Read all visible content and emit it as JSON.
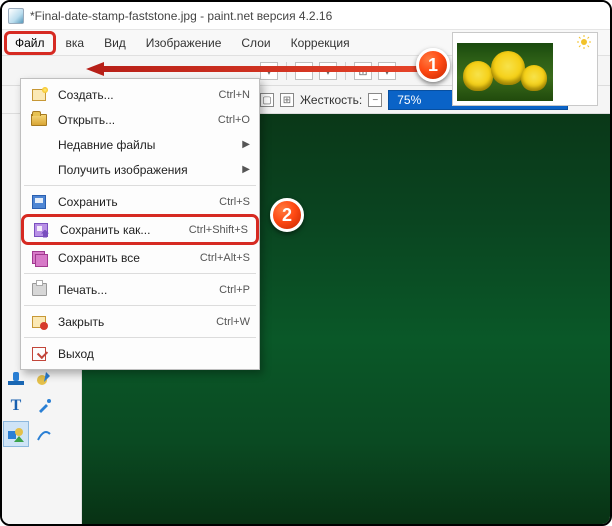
{
  "title": "*Final-date-stamp-faststone.jpg - paint.net версия 4.2.16",
  "menubar": [
    "Файл",
    "вка",
    "Вид",
    "Изображение",
    "Слои",
    "Коррекция"
  ],
  "toolbar": {
    "stiffness_label": "Жесткость:",
    "stiffness_value": "75%"
  },
  "dropdown": [
    {
      "label": "Создать...",
      "shortcut": "Ctrl+N",
      "icon": "new"
    },
    {
      "label": "Открыть...",
      "shortcut": "Ctrl+O",
      "icon": "open"
    },
    {
      "label": "Недавние файлы",
      "shortcut": "",
      "sub": true
    },
    {
      "label": "Получить изображения",
      "shortcut": "",
      "sub": true
    },
    {
      "sep": true
    },
    {
      "label": "Сохранить",
      "shortcut": "Ctrl+S",
      "icon": "save"
    },
    {
      "label": "Сохранить как...",
      "shortcut": "Ctrl+Shift+S",
      "icon": "saveas",
      "hl": true
    },
    {
      "label": "Сохранить все",
      "shortcut": "Ctrl+Alt+S",
      "icon": "saveall"
    },
    {
      "sep": true
    },
    {
      "label": "Печать...",
      "shortcut": "Ctrl+P",
      "icon": "print"
    },
    {
      "sep": true
    },
    {
      "label": "Закрыть",
      "shortcut": "Ctrl+W",
      "icon": "close"
    },
    {
      "sep": true
    },
    {
      "label": "Выход",
      "shortcut": "",
      "icon": "exit"
    }
  ],
  "badges": {
    "one": "1",
    "two": "2"
  },
  "lefttools": {
    "text_label": "T"
  }
}
